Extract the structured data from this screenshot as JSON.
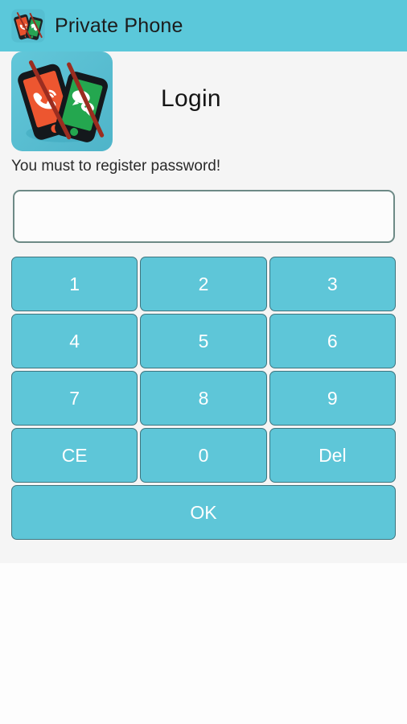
{
  "app": {
    "title": "Private Phone",
    "icon_name": "private-phone-app-icon",
    "header_bg": "#5bc8da",
    "accent": "#5ec6d8",
    "key_border": "#3f757f",
    "field_border": "#6d8a86",
    "content_bg": "#f5f5f5"
  },
  "screen": {
    "heading": "Login",
    "hint": "You must to register password!",
    "tile_icon_name": "private-phone-large-icon"
  },
  "password": {
    "value": "",
    "placeholder": ""
  },
  "keypad": {
    "rows": [
      [
        {
          "label": "1",
          "name": "key-1"
        },
        {
          "label": "2",
          "name": "key-2"
        },
        {
          "label": "3",
          "name": "key-3"
        }
      ],
      [
        {
          "label": "4",
          "name": "key-4"
        },
        {
          "label": "5",
          "name": "key-5"
        },
        {
          "label": "6",
          "name": "key-6"
        }
      ],
      [
        {
          "label": "7",
          "name": "key-7"
        },
        {
          "label": "8",
          "name": "key-8"
        },
        {
          "label": "9",
          "name": "key-9"
        }
      ],
      [
        {
          "label": "CE",
          "name": "key-clear-entry"
        },
        {
          "label": "0",
          "name": "key-0"
        },
        {
          "label": "Del",
          "name": "key-delete"
        }
      ]
    ],
    "submit": {
      "label": "OK",
      "name": "key-ok"
    }
  }
}
